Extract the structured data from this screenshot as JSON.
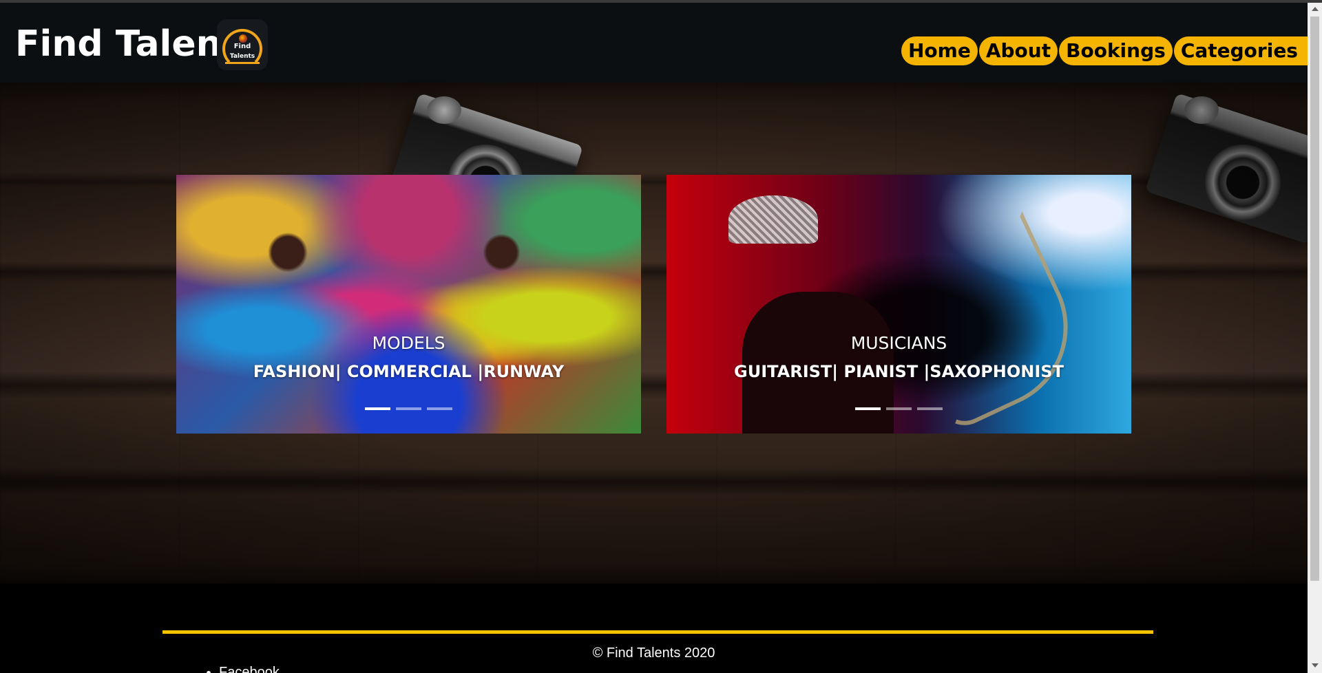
{
  "header": {
    "brand": "Find Talents",
    "logo": {
      "line1": "Find",
      "line2": "Talents",
      "accent": "#f0a51a"
    }
  },
  "nav": {
    "items": [
      {
        "label": "Home"
      },
      {
        "label": "About"
      },
      {
        "label": "Bookings"
      },
      {
        "label": "Categories",
        "icon": "caret-down-icon"
      }
    ],
    "pill_color": "#f4b400"
  },
  "carousels": [
    {
      "title": "MODELS",
      "subtitle": "FASHION| COMMERCIAL |RUNWAY",
      "indicators": {
        "count": 3,
        "active": 0
      }
    },
    {
      "title": "MUSICIANS",
      "subtitle": "GUITARIST| PIANIST |SAXOPHONIST",
      "indicators": {
        "count": 3,
        "active": 0
      }
    }
  ],
  "footer": {
    "copyright": "© Find Talents 2020",
    "social": [
      "Facebook"
    ],
    "accent_line_color": "#f4c400"
  }
}
